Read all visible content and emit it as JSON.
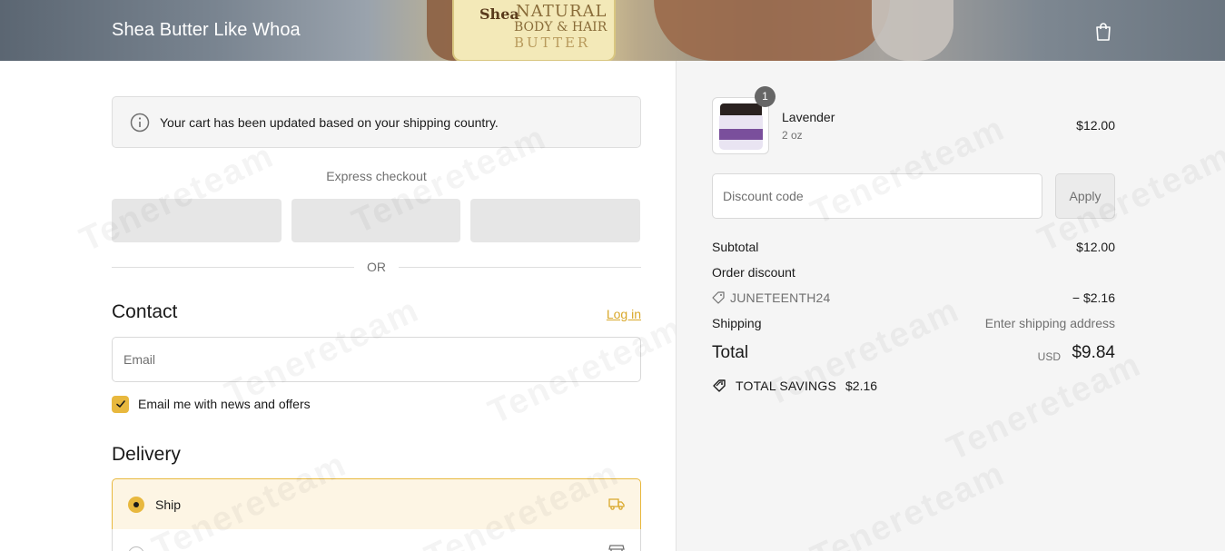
{
  "header": {
    "brand": "Shea Butter Like Whoa",
    "banner_text": {
      "line1": "Shea",
      "line2": "NATURAL",
      "line3": "BODY & HAIR",
      "line4": "BUTTER"
    },
    "cart_icon": "shopping-bag-icon"
  },
  "notice": {
    "icon": "info-icon",
    "text": "Your cart has been updated based on your shipping country."
  },
  "express": {
    "label": "Express checkout",
    "separator": "OR"
  },
  "contact": {
    "title": "Contact",
    "login_link": "Log in",
    "email_placeholder": "Email",
    "marketing_checkbox_label": "Email me with news and offers",
    "marketing_checked": true
  },
  "delivery": {
    "title": "Delivery",
    "options": [
      {
        "label": "Ship",
        "icon": "truck-icon",
        "selected": true
      },
      {
        "label": "",
        "icon": "store-icon",
        "selected": false
      }
    ]
  },
  "summary": {
    "item": {
      "name": "Lavender",
      "variant": "2 oz",
      "price": "$12.00",
      "quantity": "1"
    },
    "discount": {
      "placeholder": "Discount code",
      "apply_label": "Apply"
    },
    "subtotal_label": "Subtotal",
    "subtotal_value": "$12.00",
    "order_discount_label": "Order discount",
    "discount_code": "JUNETEENTH24",
    "discount_value": "− $2.16",
    "shipping_label": "Shipping",
    "shipping_value": "Enter shipping address",
    "total_label": "Total",
    "total_currency": "USD",
    "total_value": "$9.84",
    "savings_label": "TOTAL SAVINGS",
    "savings_value": "$2.16"
  },
  "watermark": "Tenereteam",
  "colors": {
    "accent": "#e8b83e",
    "link": "#d9a82a",
    "selected_bg": "#fdf5e4",
    "summary_bg": "#f5f5f5"
  }
}
